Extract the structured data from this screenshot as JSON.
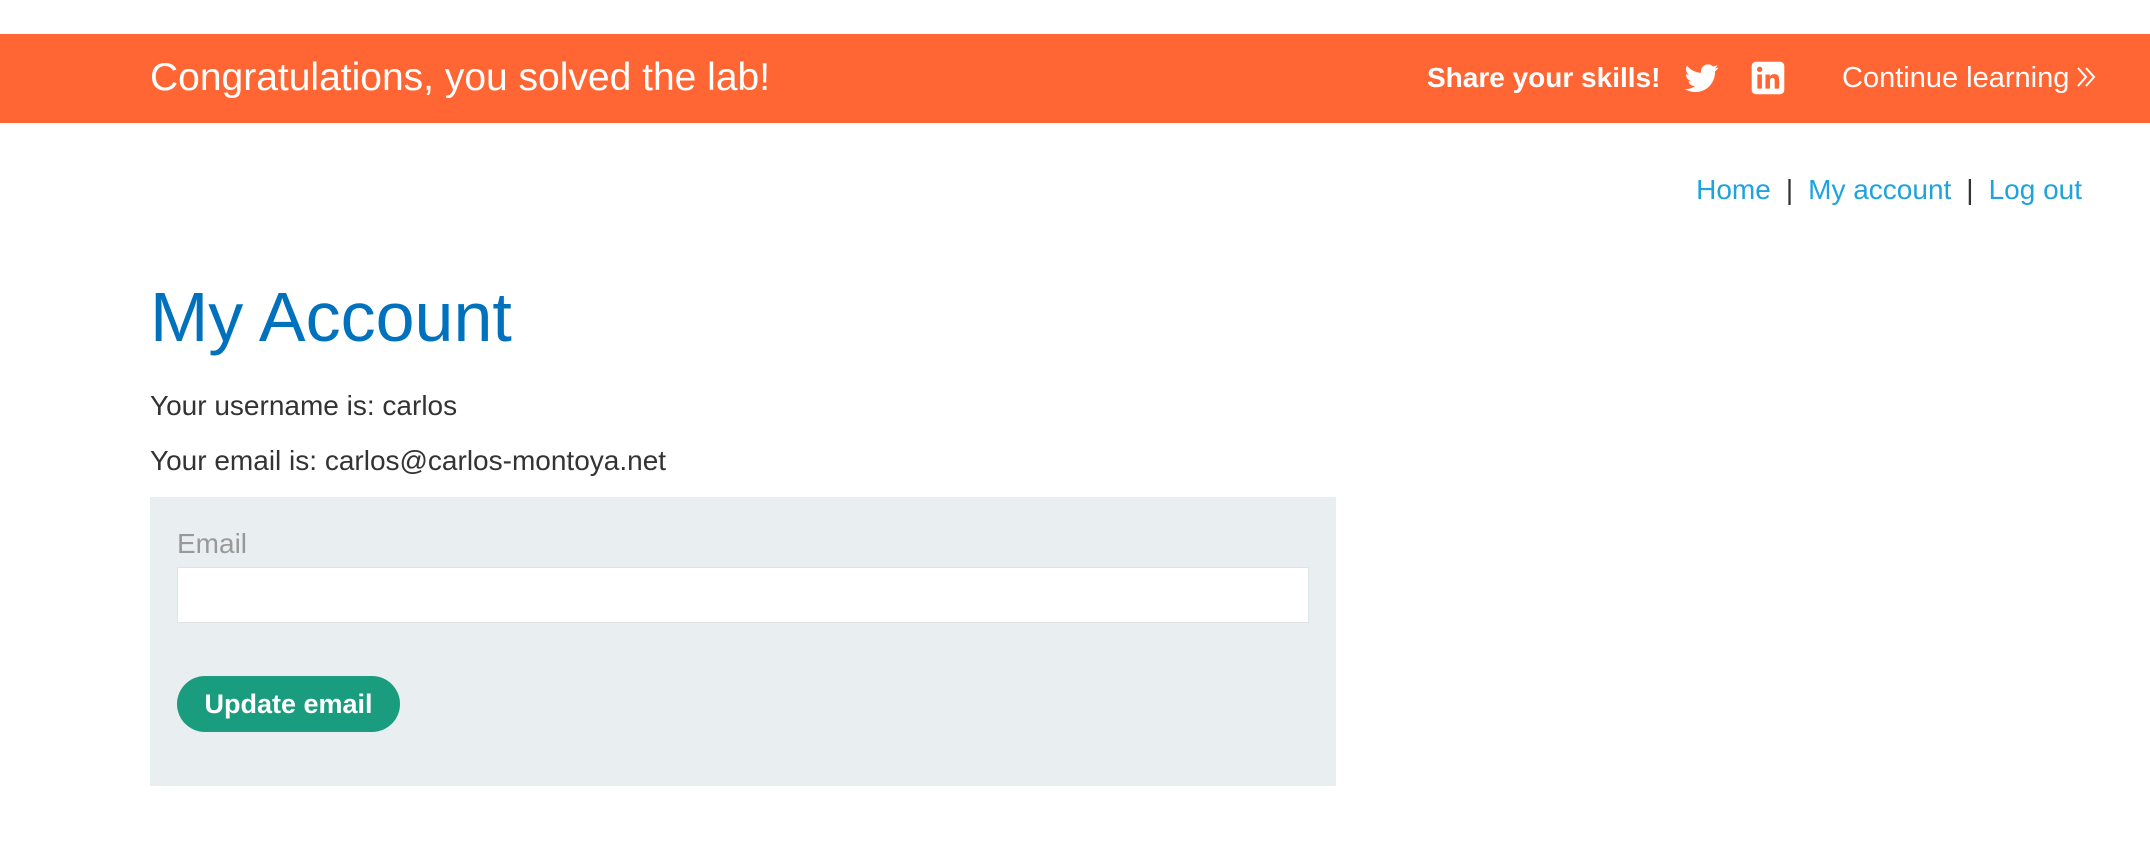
{
  "banner": {
    "title": "Congratulations, you solved the lab!",
    "share_label": "Share your skills!",
    "icons": [
      "twitter-icon",
      "linkedin-icon",
      "chevron-double-right-icon"
    ],
    "continue_label": "Continue learning",
    "background_color": "#ff6633"
  },
  "nav": {
    "home": "Home",
    "separator": "|",
    "my_account": "My account",
    "log_out": "Log out",
    "link_color": "#1fa3dd"
  },
  "main": {
    "title": "My Account",
    "username_line": "Your username is: carlos",
    "email_line": "Your email is: carlos@carlos-montoya.net",
    "title_color": "#0071bc"
  },
  "form": {
    "email_label": "Email",
    "email_value": "",
    "email_placeholder": "",
    "submit_label": "Update email",
    "panel_color": "#e9eef0",
    "button_color": "#1a9c7e"
  }
}
